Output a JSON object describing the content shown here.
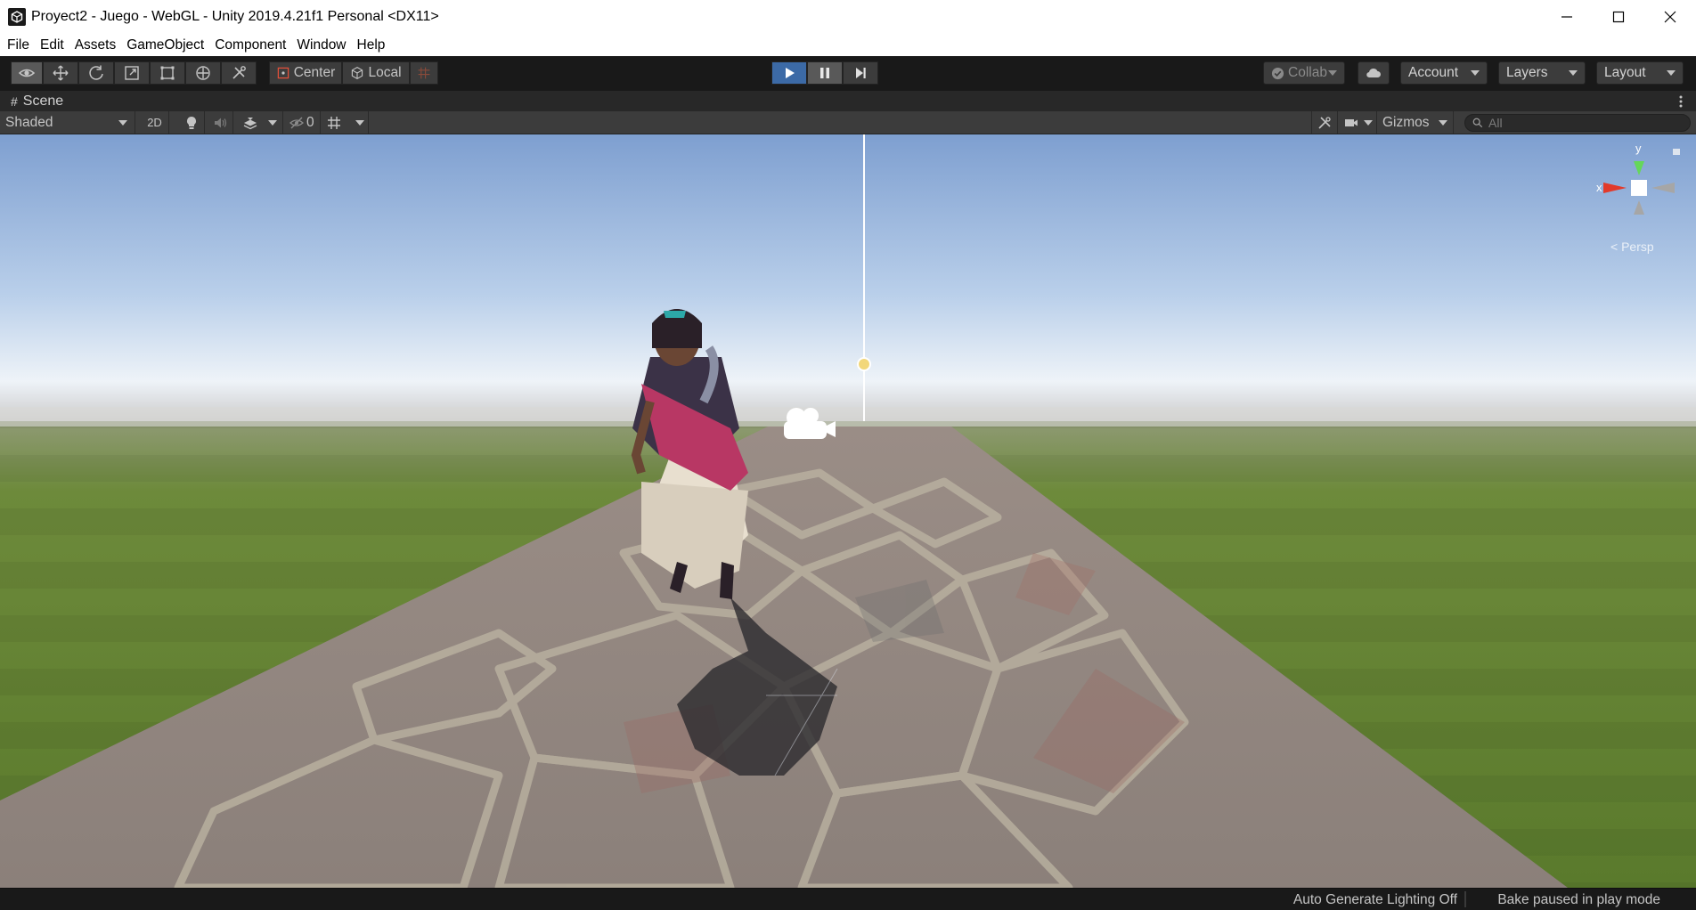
{
  "window": {
    "title": "Proyect2 - Juego - WebGL - Unity 2019.4.21f1 Personal <DX11>"
  },
  "menu": [
    "File",
    "Edit",
    "Assets",
    "GameObject",
    "Component",
    "Window",
    "Help"
  ],
  "toolbar": {
    "pivot_label": "Center",
    "space_label": "Local",
    "collab_label": "Collab",
    "account_label": "Account",
    "layers_label": "Layers",
    "layout_label": "Layout"
  },
  "scene": {
    "tab_label": "Scene",
    "shading_mode": "Shaded",
    "mode_2d_label": "2D",
    "hidden_count": "0",
    "gizmos_label": "Gizmos",
    "search_placeholder": "All",
    "gizmo_x": "x",
    "gizmo_y": "y",
    "projection_label": "< Persp"
  },
  "status": {
    "lighting": "Auto Generate Lighting Off",
    "bake": "Bake paused in play mode"
  },
  "colors": {
    "play_active": "#3c6aa6",
    "toolbar_bg": "#191919",
    "panel_bg": "#3c3c3c",
    "sky_top": "#7e9fd0",
    "grass": "#5f7a30",
    "stone_path": "#8a7f78"
  }
}
